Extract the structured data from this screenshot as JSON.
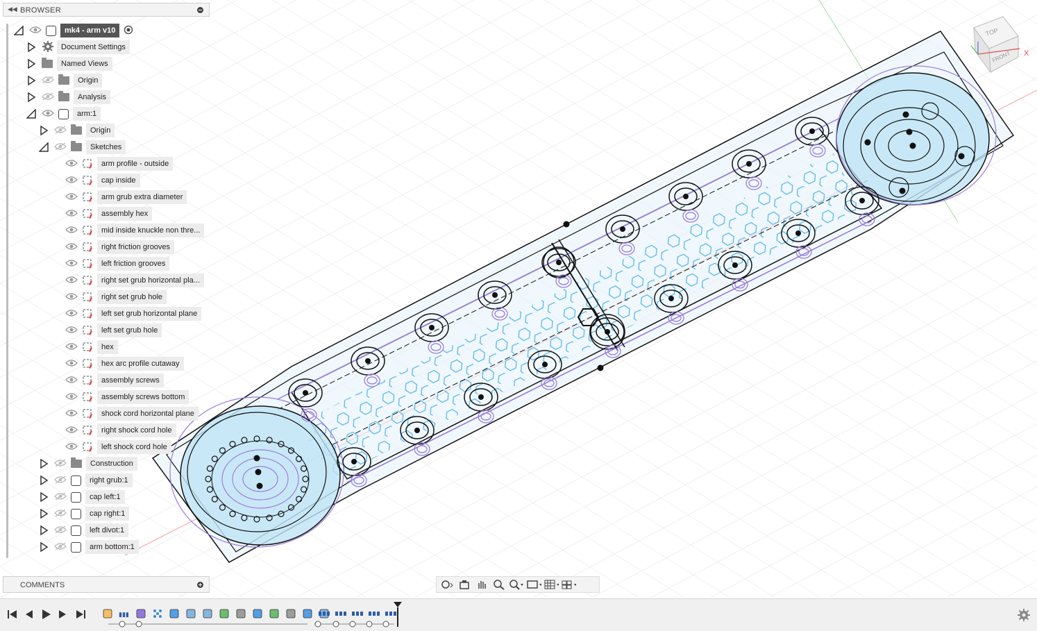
{
  "browser": {
    "title": "BROWSER",
    "document": "mk4 - arm v10",
    "items": [
      {
        "label": "Document Settings",
        "type": "settings"
      },
      {
        "label": "Named Views",
        "type": "folder"
      },
      {
        "label": "Origin",
        "type": "folder"
      },
      {
        "label": "Analysis",
        "type": "folder"
      },
      {
        "label": "arm:1",
        "type": "component"
      }
    ],
    "component_items": [
      {
        "label": "Origin",
        "type": "folder"
      },
      {
        "label": "Sketches",
        "type": "folder"
      }
    ],
    "sketches": [
      "arm profile - outside",
      "cap inside",
      "arm grub extra diameter",
      "assembly hex",
      "mid inside knuckle non thre...",
      "right friction grooves",
      "left friction grooves",
      "right set grub horizontal pla...",
      "right set grub hole",
      "left set grub horizontal plane",
      "left set grub hole",
      "hex",
      "hex arc profile cutaway",
      "assembly screws",
      "assembly screws bottom",
      "shock cord horizontal plane",
      "right shock cord hole",
      "left shock cord hole"
    ],
    "bodies": [
      {
        "label": "Construction",
        "type": "folder"
      },
      {
        "label": "right grub:1",
        "type": "body"
      },
      {
        "label": "cap left:1",
        "type": "body"
      },
      {
        "label": "cap right:1",
        "type": "body"
      },
      {
        "label": "left divot:1",
        "type": "body"
      },
      {
        "label": "arm bottom:1",
        "type": "body"
      }
    ]
  },
  "comments": {
    "title": "COMMENTS"
  },
  "viewcube": {
    "top": "TOP",
    "front": "FRONT",
    "axis_x": "X"
  },
  "navbar": {
    "icons": [
      "orbit-icon",
      "look-at-icon",
      "pan-icon",
      "zoom-window-icon",
      "zoom-icon",
      "display-settings-icon",
      "grid-icon",
      "viewports-icon"
    ]
  },
  "timeline": {
    "controls": [
      "go-to-start-icon",
      "step-back-icon",
      "play-icon",
      "step-forward-icon",
      "go-to-end-icon"
    ]
  },
  "colors": {
    "hex_pattern": "#4fb3e8",
    "sketch_line": "#111111",
    "profile_fill": "#cfe9f7",
    "construction": "#9b7ddb"
  }
}
